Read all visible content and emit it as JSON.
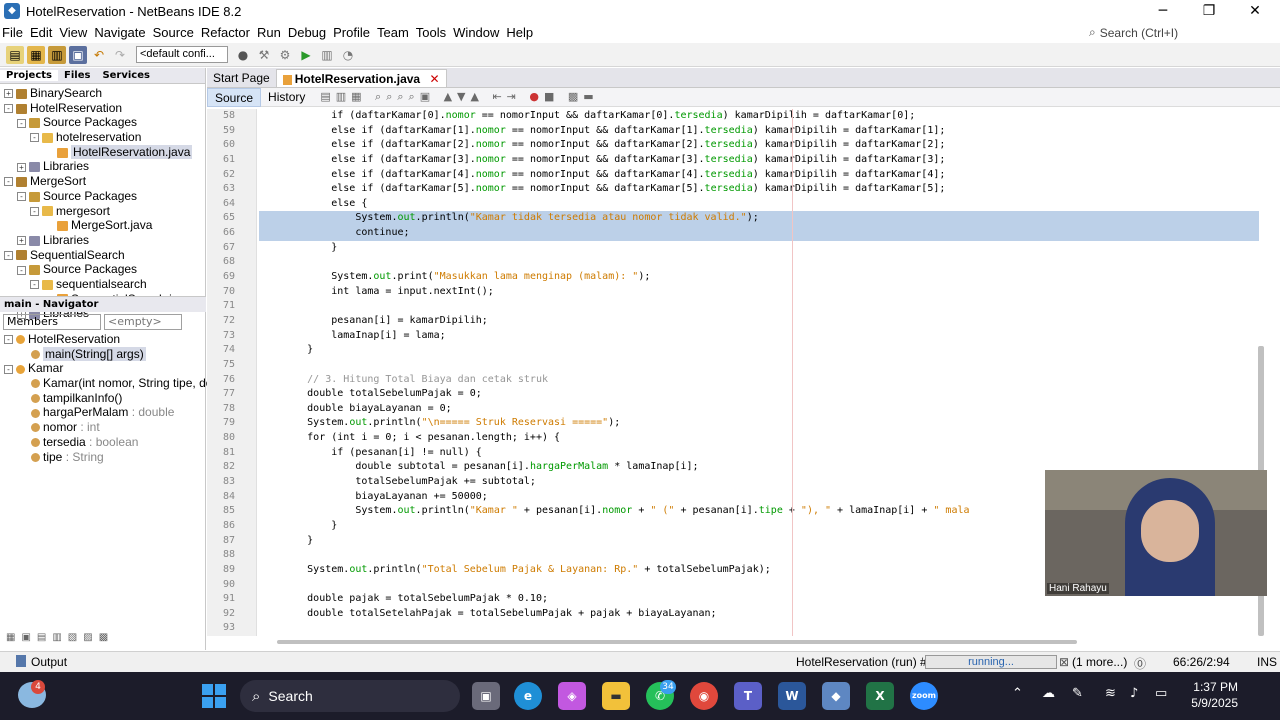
{
  "window": {
    "title": "HotelReservation - NetBeans IDE 8.2",
    "search_placeholder": "Search (Ctrl+I)"
  },
  "menu": [
    "File",
    "Edit",
    "View",
    "Navigate",
    "Source",
    "Refactor",
    "Run",
    "Debug",
    "Profile",
    "Team",
    "Tools",
    "Window",
    "Help"
  ],
  "toolbar": {
    "config": "<default confi..."
  },
  "projects": {
    "tabs": [
      "Projects",
      "Files",
      "Services"
    ],
    "tree": [
      {
        "label": "BinarySearch",
        "level": 0,
        "icon": "project-icon",
        "exp": "+"
      },
      {
        "label": "HotelReservation",
        "level": 0,
        "icon": "project-icon",
        "exp": "-"
      },
      {
        "label": "Source Packages",
        "level": 1,
        "icon": "package-folder-icon",
        "exp": "-"
      },
      {
        "label": "hotelreservation",
        "level": 2,
        "icon": "package-icon",
        "exp": "-"
      },
      {
        "label": "HotelReservation.java",
        "level": 3,
        "icon": "java-file-icon",
        "exp": "",
        "sel": true
      },
      {
        "label": "Libraries",
        "level": 1,
        "icon": "library-icon",
        "exp": "+"
      },
      {
        "label": "MergeSort",
        "level": 0,
        "icon": "project-icon",
        "exp": "-"
      },
      {
        "label": "Source Packages",
        "level": 1,
        "icon": "package-folder-icon",
        "exp": "-"
      },
      {
        "label": "mergesort",
        "level": 2,
        "icon": "package-icon",
        "exp": "-"
      },
      {
        "label": "MergeSort.java",
        "level": 3,
        "icon": "java-file-icon",
        "exp": ""
      },
      {
        "label": "Libraries",
        "level": 1,
        "icon": "library-icon",
        "exp": "+"
      },
      {
        "label": "SequentialSearch",
        "level": 0,
        "icon": "project-icon",
        "exp": "-"
      },
      {
        "label": "Source Packages",
        "level": 1,
        "icon": "package-folder-icon",
        "exp": "-"
      },
      {
        "label": "sequentialsearch",
        "level": 2,
        "icon": "package-icon",
        "exp": "-"
      },
      {
        "label": "SequentialSearch.java",
        "level": 3,
        "icon": "java-file-icon",
        "exp": ""
      },
      {
        "label": "Libraries",
        "level": 1,
        "icon": "library-icon",
        "exp": "+"
      }
    ]
  },
  "navigator": {
    "title": "main - Navigator",
    "filter": "Members",
    "filter2": "<empty>",
    "items": [
      {
        "label": "HotelReservation",
        "type": "",
        "level": 0,
        "exp": "-"
      },
      {
        "label": "main(String[] args)",
        "type": "",
        "level": 1,
        "exp": "",
        "sel": true
      },
      {
        "label": "Kamar",
        "type": "",
        "level": 0,
        "exp": "-"
      },
      {
        "label": "Kamar(int nomor, String tipe, dou",
        "type": "",
        "level": 1,
        "exp": ""
      },
      {
        "label": "tampilkanInfo()",
        "type": "",
        "level": 1,
        "exp": ""
      },
      {
        "label": "hargaPerMalam",
        "type": " : double",
        "level": 1,
        "exp": ""
      },
      {
        "label": "nomor",
        "type": " : int",
        "level": 1,
        "exp": ""
      },
      {
        "label": "tersedia",
        "type": " : boolean",
        "level": 1,
        "exp": ""
      },
      {
        "label": "tipe",
        "type": " : String",
        "level": 1,
        "exp": ""
      }
    ]
  },
  "editor": {
    "tabs": [
      "Start Page",
      "HotelReservation.java"
    ],
    "source_label": "Source",
    "history_label": "History",
    "lines": [
      {
        "n": "58",
        "segs": [
          [
            "",
            "            if (daftarKamar[0]."
          ],
          [
            "fld",
            "nomor"
          ],
          [
            "",
            " == nomorInput && daftarKamar[0]."
          ],
          [
            "fld",
            "tersedia"
          ],
          [
            "",
            ") kamarDipilih = daftarKamar[0];"
          ]
        ]
      },
      {
        "n": "59",
        "segs": [
          [
            "",
            "            else if (daftarKamar[1]."
          ],
          [
            "fld",
            "nomor"
          ],
          [
            "",
            " == nomorInput && daftarKamar[1]."
          ],
          [
            "fld",
            "tersedia"
          ],
          [
            "",
            ") kamarDipilih = daftarKamar[1];"
          ]
        ]
      },
      {
        "n": "60",
        "segs": [
          [
            "",
            "            else if (daftarKamar[2]."
          ],
          [
            "fld",
            "nomor"
          ],
          [
            "",
            " == nomorInput && daftarKamar[2]."
          ],
          [
            "fld",
            "tersedia"
          ],
          [
            "",
            ") kamarDipilih = daftarKamar[2];"
          ]
        ]
      },
      {
        "n": "61",
        "segs": [
          [
            "",
            "            else if (daftarKamar[3]."
          ],
          [
            "fld",
            "nomor"
          ],
          [
            "",
            " == nomorInput && daftarKamar[3]."
          ],
          [
            "fld",
            "tersedia"
          ],
          [
            "",
            ") kamarDipilih = daftarKamar[3];"
          ]
        ]
      },
      {
        "n": "62",
        "segs": [
          [
            "",
            "            else if (daftarKamar[4]."
          ],
          [
            "fld",
            "nomor"
          ],
          [
            "",
            " == nomorInput && daftarKamar[4]."
          ],
          [
            "fld",
            "tersedia"
          ],
          [
            "",
            ") kamarDipilih = daftarKamar[4];"
          ]
        ]
      },
      {
        "n": "63",
        "segs": [
          [
            "",
            "            else if (daftarKamar[5]."
          ],
          [
            "fld",
            "nomor"
          ],
          [
            "",
            " == nomorInput && daftarKamar[5]."
          ],
          [
            "fld",
            "tersedia"
          ],
          [
            "",
            ") kamarDipilih = daftarKamar[5];"
          ]
        ]
      },
      {
        "n": "64",
        "segs": [
          [
            "",
            "            else {"
          ]
        ]
      },
      {
        "n": "65",
        "hl": true,
        "segs": [
          [
            "",
            "                System."
          ],
          [
            "fld",
            "out"
          ],
          [
            "",
            ".println("
          ],
          [
            "str",
            "\"Kamar tidak tersedia atau nomor tidak valid.\""
          ],
          [
            "",
            ");"
          ]
        ]
      },
      {
        "n": "66",
        "hl": true,
        "segs": [
          [
            "",
            "                continue;"
          ]
        ]
      },
      {
        "n": "67",
        "segs": [
          [
            "",
            "            }"
          ]
        ]
      },
      {
        "n": "68",
        "segs": [
          [
            "",
            ""
          ]
        ]
      },
      {
        "n": "69",
        "segs": [
          [
            "",
            "            System."
          ],
          [
            "fld",
            "out"
          ],
          [
            "",
            ".print("
          ],
          [
            "str",
            "\"Masukkan lama menginap (malam): \""
          ],
          [
            "",
            ");"
          ]
        ]
      },
      {
        "n": "70",
        "segs": [
          [
            "",
            "            int lama = input.nextInt();"
          ]
        ]
      },
      {
        "n": "71",
        "segs": [
          [
            "",
            ""
          ]
        ]
      },
      {
        "n": "72",
        "segs": [
          [
            "",
            "            pesanan[i] = kamarDipilih;"
          ]
        ]
      },
      {
        "n": "73",
        "segs": [
          [
            "",
            "            lamaInap[i] = lama;"
          ]
        ]
      },
      {
        "n": "74",
        "segs": [
          [
            "",
            "        }"
          ]
        ]
      },
      {
        "n": "75",
        "segs": [
          [
            "",
            ""
          ]
        ]
      },
      {
        "n": "76",
        "segs": [
          [
            "cmt",
            "        // 3. Hitung Total Biaya dan cetak struk"
          ]
        ]
      },
      {
        "n": "77",
        "segs": [
          [
            "",
            "        double totalSebelumPajak = 0;"
          ]
        ]
      },
      {
        "n": "78",
        "segs": [
          [
            "",
            "        double biayaLayanan = 0;"
          ]
        ]
      },
      {
        "n": "79",
        "segs": [
          [
            "",
            "        System."
          ],
          [
            "fld",
            "out"
          ],
          [
            "",
            ".println("
          ],
          [
            "str",
            "\"\\n===== Struk Reservasi =====\""
          ],
          [
            "",
            ");"
          ]
        ]
      },
      {
        "n": "80",
        "segs": [
          [
            "",
            "        for (int i = 0; i < pesanan.length; i++) {"
          ]
        ]
      },
      {
        "n": "81",
        "segs": [
          [
            "",
            "            if (pesanan[i] != null) {"
          ]
        ]
      },
      {
        "n": "82",
        "segs": [
          [
            "",
            "                double subtotal = pesanan[i]."
          ],
          [
            "fld",
            "hargaPerMalam"
          ],
          [
            "",
            " * lamaInap[i];"
          ]
        ]
      },
      {
        "n": "83",
        "segs": [
          [
            "",
            "                totalSebelumPajak += subtotal;"
          ]
        ]
      },
      {
        "n": "84",
        "segs": [
          [
            "",
            "                biayaLayanan += 50000;"
          ]
        ]
      },
      {
        "n": "85",
        "segs": [
          [
            "",
            "                System."
          ],
          [
            "fld",
            "out"
          ],
          [
            "",
            ".println("
          ],
          [
            "str",
            "\"Kamar \""
          ],
          [
            "",
            " + pesanan[i]."
          ],
          [
            "fld",
            "nomor"
          ],
          [
            "",
            " + "
          ],
          [
            "str",
            "\" (\""
          ],
          [
            "",
            " + pesanan[i]."
          ],
          [
            "fld",
            "tipe"
          ],
          [
            "",
            " + "
          ],
          [
            "str",
            "\"), \""
          ],
          [
            "",
            " + lamaInap[i] + "
          ],
          [
            "str",
            "\" mala"
          ]
        ]
      },
      {
        "n": "86",
        "segs": [
          [
            "",
            "            }"
          ]
        ]
      },
      {
        "n": "87",
        "segs": [
          [
            "",
            "        }"
          ]
        ]
      },
      {
        "n": "88",
        "segs": [
          [
            "",
            ""
          ]
        ]
      },
      {
        "n": "89",
        "segs": [
          [
            "",
            "        System."
          ],
          [
            "fld",
            "out"
          ],
          [
            "",
            ".println("
          ],
          [
            "str",
            "\"Total Sebelum Pajak & Layanan: Rp.\""
          ],
          [
            "",
            " + totalSebelumPajak);"
          ]
        ]
      },
      {
        "n": "90",
        "segs": [
          [
            "",
            ""
          ]
        ]
      },
      {
        "n": "91",
        "segs": [
          [
            "",
            "        double pajak = totalSebelumPajak * 0.10;"
          ]
        ]
      },
      {
        "n": "92",
        "segs": [
          [
            "",
            "        double totalSetelahPajak = totalSebelumPajak + pajak + biayaLayanan;"
          ]
        ]
      },
      {
        "n": "93",
        "segs": [
          [
            "",
            ""
          ]
        ]
      }
    ]
  },
  "status": {
    "output": "Output",
    "run": "HotelReservation (run) #2",
    "progress": "running...",
    "more": "(1 more...)",
    "position": "66:26/2:94",
    "mode": "INS"
  },
  "video": {
    "name": "Hani Rahayu"
  },
  "taskbar": {
    "search": "Search",
    "badge": "4",
    "whatsapp_badge": "34",
    "time": "1:37 PM",
    "date": "5/9/2025"
  }
}
